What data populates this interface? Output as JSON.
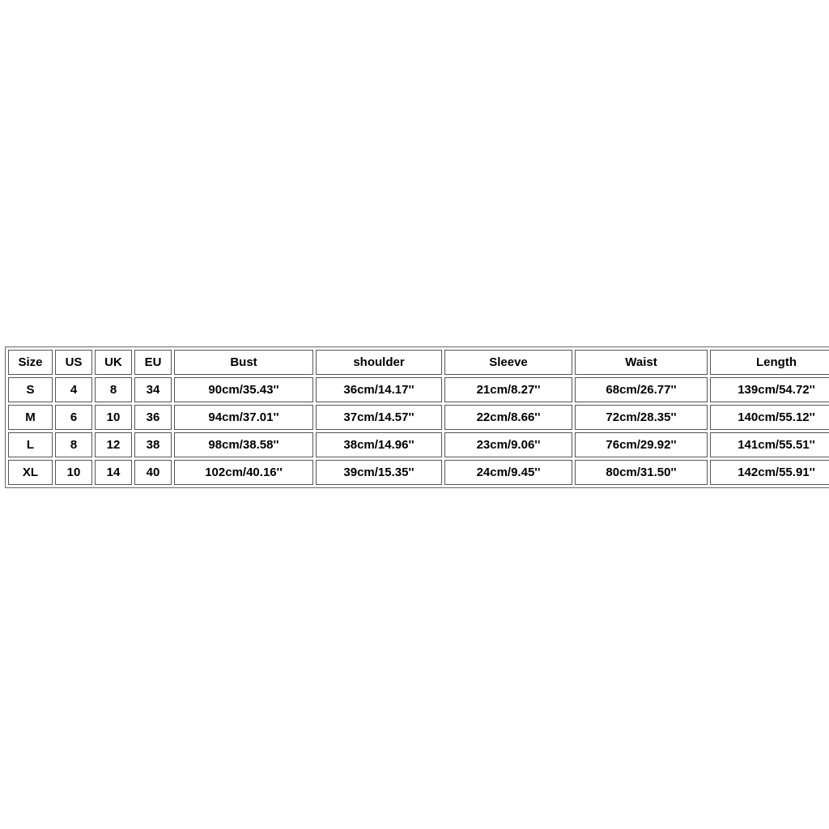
{
  "chart_data": {
    "type": "table",
    "headers": [
      "Size",
      "US",
      "UK",
      "EU",
      "Bust",
      "shoulder",
      "Sleeve",
      "Waist",
      "Length"
    ],
    "rows": [
      {
        "size": "S",
        "us": "4",
        "uk": "8",
        "eu": "34",
        "bust": "90cm/35.43''",
        "shoulder": "36cm/14.17''",
        "sleeve": "21cm/8.27''",
        "waist": "68cm/26.77''",
        "length": "139cm/54.72''"
      },
      {
        "size": "M",
        "us": "6",
        "uk": "10",
        "eu": "36",
        "bust": "94cm/37.01''",
        "shoulder": "37cm/14.57''",
        "sleeve": "22cm/8.66''",
        "waist": "72cm/28.35''",
        "length": "140cm/55.12''"
      },
      {
        "size": "L",
        "us": "8",
        "uk": "12",
        "eu": "38",
        "bust": "98cm/38.58''",
        "shoulder": "38cm/14.96''",
        "sleeve": "23cm/9.06''",
        "waist": "76cm/29.92''",
        "length": "141cm/55.51''"
      },
      {
        "size": "XL",
        "us": "10",
        "uk": "14",
        "eu": "40",
        "bust": "102cm/40.16''",
        "shoulder": "39cm/15.35''",
        "sleeve": "24cm/9.45''",
        "waist": "80cm/31.50''",
        "length": "142cm/55.91''"
      }
    ]
  }
}
